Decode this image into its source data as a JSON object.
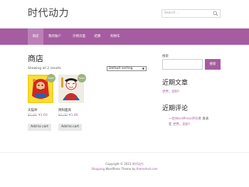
{
  "header": {
    "site_title": "时代动力",
    "search_placeholder": "Search ..."
  },
  "nav": {
    "items": [
      "商店",
      "我的账户",
      "示例页面",
      "结算",
      "购物车"
    ]
  },
  "main": {
    "title": "商店",
    "result_count": "Showing all 2 results",
    "ordering": "Default sorting",
    "products": [
      {
        "name": "天猫师",
        "old_price": "¥1.80",
        "new_price": "¥1.60",
        "sale": "Sale!",
        "button": "Add to cart"
      },
      {
        "name": "阴阳面具",
        "old_price": "¥2.00",
        "new_price": "¥1.80",
        "sale": "Sale!",
        "button": "Add to cart"
      }
    ]
  },
  "sidebar": {
    "search_label": "搜索",
    "search_button": "搜索",
    "recent_posts_title": "近期文章",
    "recent_posts": [
      "世界，您好！"
    ],
    "recent_comments_title": "近期评论",
    "recent_comment_author": "一位WordPress评论者",
    "recent_comment_middle": "发表在",
    "recent_comment_post": "世界，您好！"
  },
  "footer": {
    "line1_prefix": "Copyright © 2023",
    "line1_site": "时代动力",
    "line2_prefix": "Shopping",
    "line2_rest": "WordPress Theme by",
    "line2_author": "themehall.com"
  },
  "colors": {
    "accent": "#a65ca0",
    "nav_active": "#bc80b7",
    "sale_badge": "#9db37a"
  }
}
